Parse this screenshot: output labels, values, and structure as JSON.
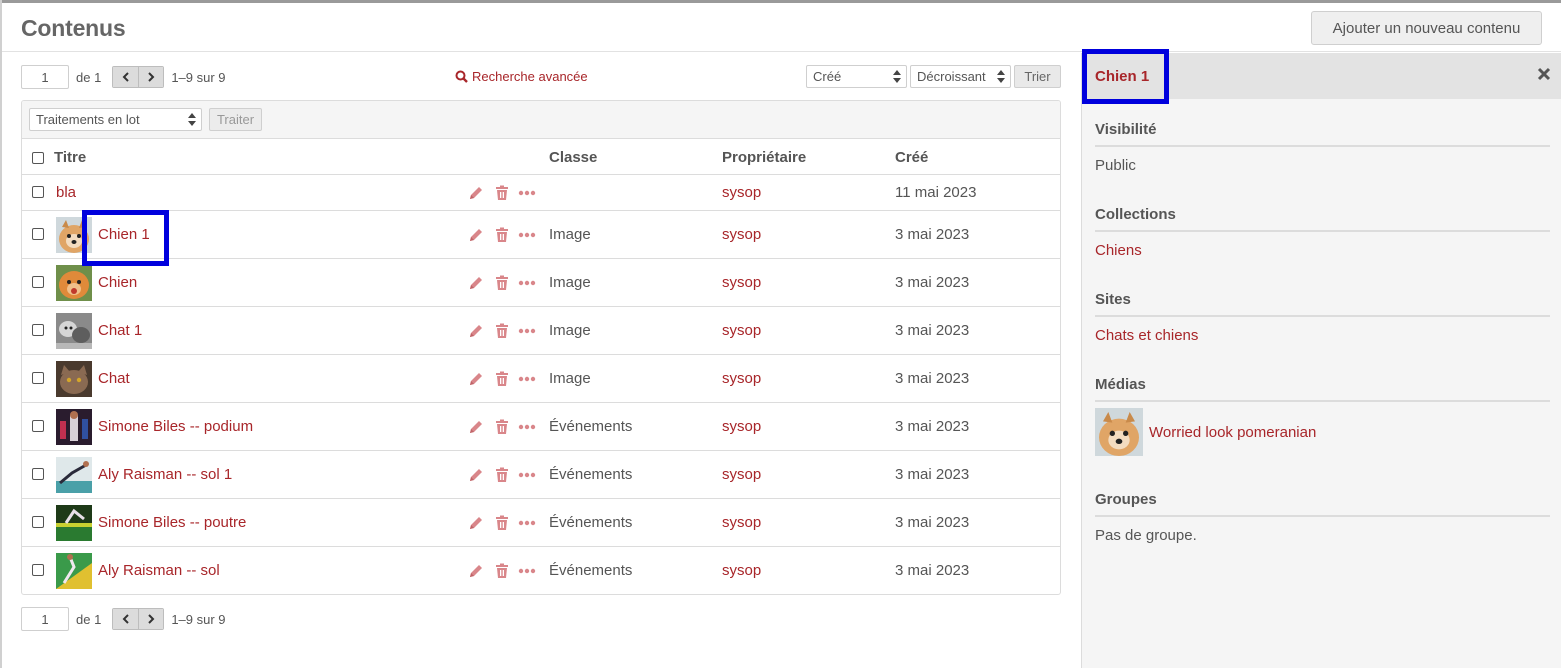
{
  "header": {
    "title": "Contenus",
    "add_button": "Ajouter un nouveau contenu"
  },
  "pager_top": {
    "page": "1",
    "of": "de 1",
    "range": "1–9 sur 9"
  },
  "pager_bottom": {
    "page": "1",
    "of": "de 1",
    "range": "1–9 sur 9"
  },
  "advanced_search": "Recherche avancée",
  "sort": {
    "field": "Créé",
    "order": "Décroissant",
    "button": "Trier"
  },
  "batch": {
    "select": "Traitements en lot",
    "button": "Traiter"
  },
  "columns": {
    "title": "Titre",
    "class": "Classe",
    "owner": "Propriétaire",
    "created": "Créé"
  },
  "rows": [
    {
      "title": "bla",
      "class": "",
      "owner": "sysop",
      "created": "11 mai 2023",
      "thumb": ""
    },
    {
      "title": "Chien 1",
      "class": "Image",
      "owner": "sysop",
      "created": "3 mai 2023",
      "thumb": "pomeranian-thumb"
    },
    {
      "title": "Chien",
      "class": "Image",
      "owner": "sysop",
      "created": "3 mai 2023",
      "thumb": "dog-thumb"
    },
    {
      "title": "Chat 1",
      "class": "Image",
      "owner": "sysop",
      "created": "3 mai 2023",
      "thumb": "cat-kittens-thumb"
    },
    {
      "title": "Chat",
      "class": "Image",
      "owner": "sysop",
      "created": "3 mai 2023",
      "thumb": "grey-cat-thumb"
    },
    {
      "title": "Simone Biles -- podium",
      "class": "Événements",
      "owner": "sysop",
      "created": "3 mai 2023",
      "thumb": "podium-thumb"
    },
    {
      "title": "Aly Raisman -- sol 1",
      "class": "Événements",
      "owner": "sysop",
      "created": "3 mai 2023",
      "thumb": "floor-thumb"
    },
    {
      "title": "Simone Biles -- poutre",
      "class": "Événements",
      "owner": "sysop",
      "created": "3 mai 2023",
      "thumb": "beam-thumb"
    },
    {
      "title": "Aly Raisman -- sol",
      "class": "Événements",
      "owner": "sysop",
      "created": "3 mai 2023",
      "thumb": "floor2-thumb"
    }
  ],
  "panel": {
    "title": "Chien 1",
    "visibility_label": "Visibilité",
    "visibility_value": "Public",
    "collections_label": "Collections",
    "collections_value": "Chiens",
    "sites_label": "Sites",
    "sites_value": "Chats et chiens",
    "media_label": "Médias",
    "media_value": "Worried look pomeranian",
    "groups_label": "Groupes",
    "groups_value": "Pas de groupe."
  },
  "colors": {
    "link": "#a8262a",
    "highlight": "#0000dd",
    "text": "#555555",
    "panel_bg": "#f5f5f5"
  }
}
